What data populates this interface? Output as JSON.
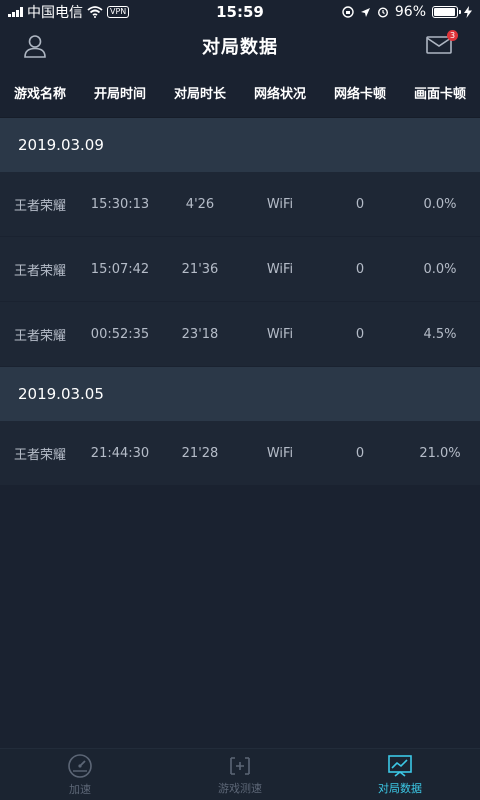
{
  "status_bar": {
    "carrier": "中国电信",
    "vpn": "VPN",
    "time": "15:59",
    "battery_percent": "96%",
    "battery_level": 0.96
  },
  "header": {
    "title": "对局数据",
    "mail_badge": "3"
  },
  "columns": [
    "游戏名称",
    "开局时间",
    "对局时长",
    "网络状况",
    "网络卡顿",
    "画面卡顿"
  ],
  "groups": [
    {
      "date": "2019.03.09",
      "rows": [
        [
          "王者荣耀",
          "15:30:13",
          "4'26",
          "WiFi",
          "0",
          "0.0%"
        ],
        [
          "王者荣耀",
          "15:07:42",
          "21'36",
          "WiFi",
          "0",
          "0.0%"
        ],
        [
          "王者荣耀",
          "00:52:35",
          "23'18",
          "WiFi",
          "0",
          "4.5%"
        ]
      ]
    },
    {
      "date": "2019.03.05",
      "rows": [
        [
          "王者荣耀",
          "21:44:30",
          "21'28",
          "WiFi",
          "0",
          "21.0%"
        ]
      ]
    }
  ],
  "tabs": [
    {
      "label": "加速",
      "icon": "speedometer-icon"
    },
    {
      "label": "游戏测速",
      "icon": "speed-test-icon"
    },
    {
      "label": "对局数据",
      "icon": "chart-icon"
    }
  ],
  "colors": {
    "accent": "#3cc8e6",
    "badge": "#e0343a",
    "background": "#1a2230"
  }
}
